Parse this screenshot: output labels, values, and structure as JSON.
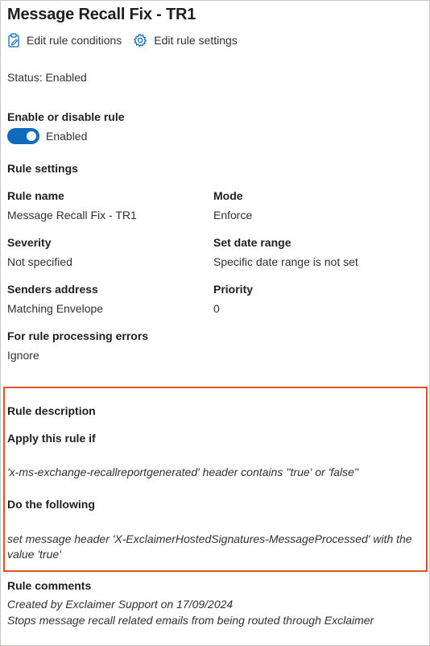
{
  "panel": {
    "title": "Message Recall Fix - TR1",
    "commands": {
      "edit_conditions": "Edit rule conditions",
      "edit_settings": "Edit rule settings"
    },
    "status": "Status: Enabled",
    "enable_section": {
      "heading": "Enable or disable rule",
      "toggle_state": "on",
      "toggle_label": "Enabled"
    },
    "rule_settings": {
      "heading": "Rule settings",
      "fields": [
        {
          "label": "Rule name",
          "value": "Message Recall Fix - TR1"
        },
        {
          "label": "Mode",
          "value": "Enforce"
        },
        {
          "label": "Severity",
          "value": "Not specified"
        },
        {
          "label": "Set date range",
          "value": "Specific date range is not set"
        },
        {
          "label": "Senders address",
          "value": "Matching Envelope"
        },
        {
          "label": "Priority",
          "value": "0"
        },
        {
          "label": "For rule processing errors",
          "value": "Ignore"
        }
      ]
    },
    "rule_description": {
      "heading": "Rule description",
      "apply_heading": "Apply this rule if",
      "apply_text": "'x-ms-exchange-recallreportgenerated' header contains ''true' or 'false''",
      "do_heading": "Do the following",
      "do_text": "set message header 'X-ExclaimerHostedSignatures-MessageProcessed' with the value 'true'"
    },
    "rule_comments": {
      "heading": "Rule comments",
      "lines": [
        "Created by Exclaimer Support on 17/09/2024",
        "Stops message recall related emails from being routed through Exclaimer"
      ]
    }
  },
  "colors": {
    "accent": "#0f6cbd",
    "highlight_border": "#e0532a",
    "text": "#323130"
  },
  "icons": {
    "edit_conditions": "clipboard-edit-icon",
    "edit_settings": "gear-icon"
  }
}
